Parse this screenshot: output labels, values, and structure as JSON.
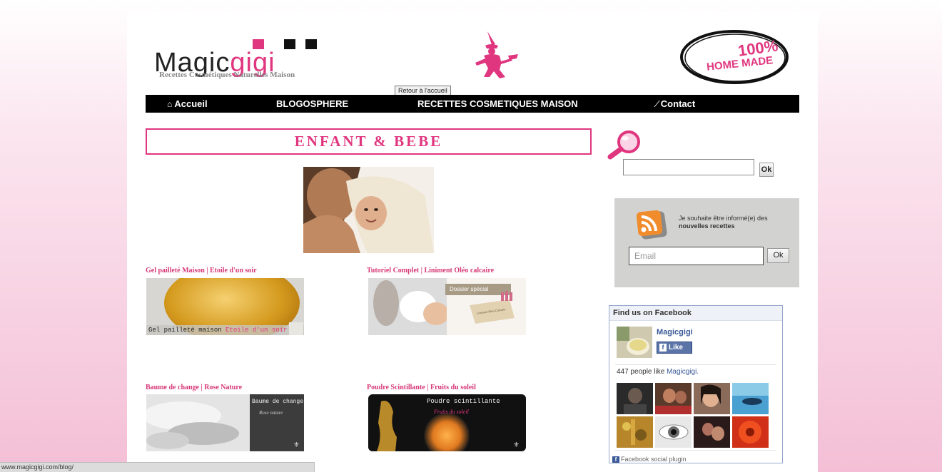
{
  "header": {
    "logo_part1": "Magic",
    "logo_part2": "gigi",
    "tagline": "Recettes Cosmétiques Naturelles Maison",
    "badge_line1": "100%",
    "badge_line2": "HOME MADE",
    "tooltip": "Retour à l'accueil"
  },
  "nav": {
    "items": [
      {
        "label": "Accueil",
        "icon": "home-icon"
      },
      {
        "label": "BLOGOSPHERE"
      },
      {
        "label": "RECETTES COSMETIQUES MAISON"
      },
      {
        "label": "Contact",
        "icon": "pencil-icon"
      }
    ]
  },
  "main": {
    "category_title": "ENFANT & BEBE",
    "posts": [
      {
        "title": "Gel pailleté Maison | Etoile d'un soir",
        "thumb_text1": "Gel pailleté maison",
        "thumb_text2": "Etoile d'un soir"
      },
      {
        "title": "Tutoriel Complet | Liniment Oléo calcaire",
        "thumb_text1": "Dossier spécial",
        "thumb_text2": "Liniment Oléo-Calcaire"
      },
      {
        "title": "Baume de change | Rose Nature",
        "thumb_text1": "Baume de change",
        "thumb_text2": "Rose nature"
      },
      {
        "title": "Poudre Scintillante | Fruits du soleil",
        "thumb_text1": "Poudre scintillante",
        "thumb_text2": "Fruits du soleil"
      }
    ]
  },
  "sidebar": {
    "search": {
      "value": "",
      "button": "Ok"
    },
    "newsletter": {
      "text_line1": "Je souhaite être informé(e) des",
      "text_line2": "nouvelles recettes",
      "placeholder": "Email",
      "button": "Ok"
    },
    "facebook": {
      "header": "Find us on Facebook",
      "page_name": "Magicgigi",
      "like_button": "Like",
      "count_text": "447 people like",
      "count_link": "Magicgigi.",
      "footer": "Facebook social plugin"
    }
  },
  "statusbar": {
    "url": "www.magicgigi.com/blog/"
  },
  "colors": {
    "accent": "#e0367f",
    "nav_bg": "#000000",
    "facebook": "#3b5998"
  }
}
